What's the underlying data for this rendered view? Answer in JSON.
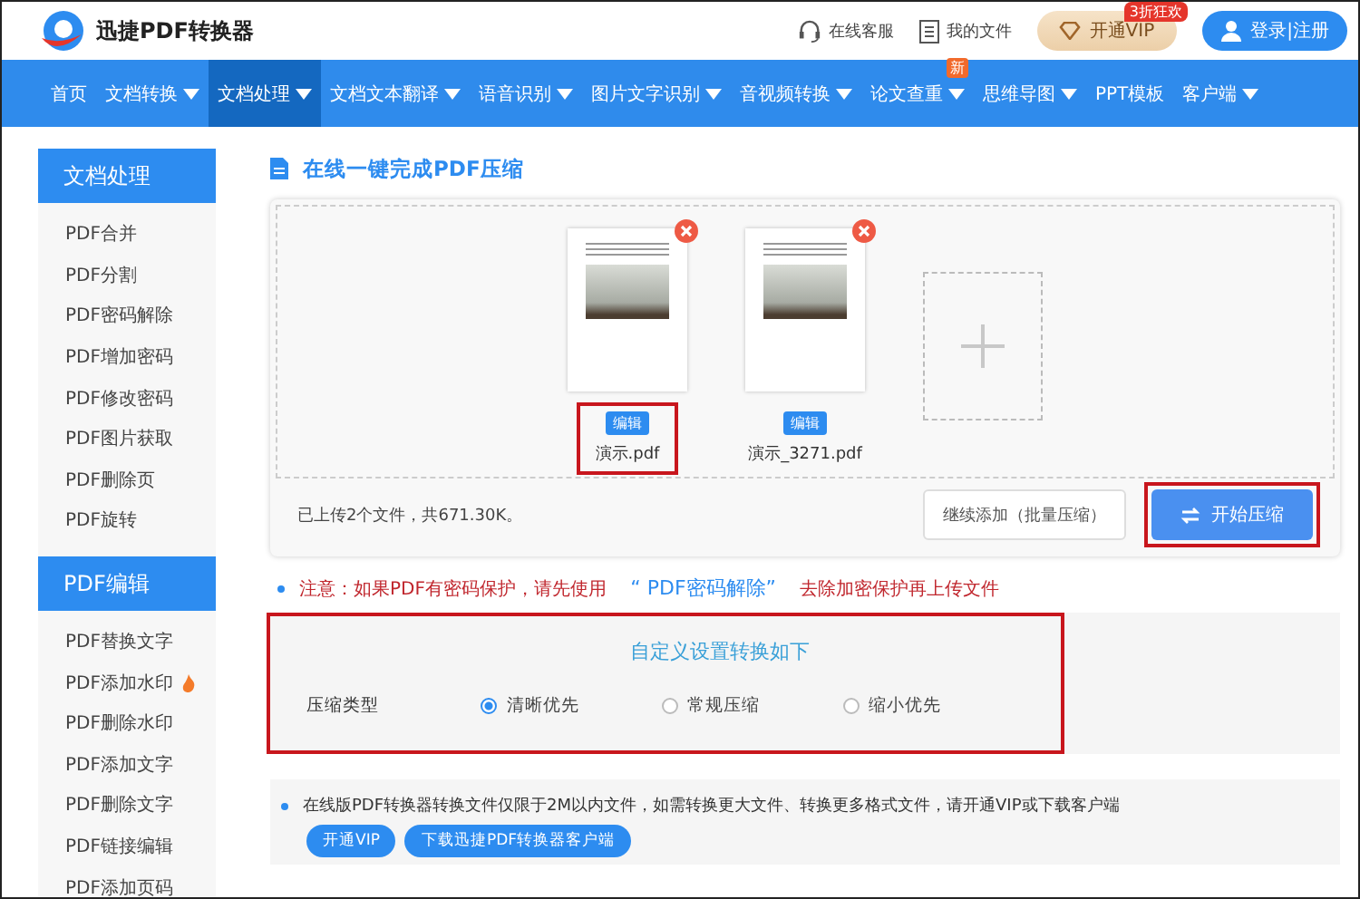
{
  "brand": {
    "name": "迅捷PDF转换器"
  },
  "top_links": [
    {
      "kind": "headset",
      "label": "在线客服"
    },
    {
      "kind": "file",
      "label": "我的文件"
    }
  ],
  "vip": {
    "label": "开通VIP",
    "badge": "3折狂欢"
  },
  "login": {
    "label": "登录|注册"
  },
  "nav": [
    {
      "label": "首页",
      "dropdown": false,
      "selected": false
    },
    {
      "label": "文档转换",
      "dropdown": true,
      "selected": false
    },
    {
      "label": "文档处理",
      "dropdown": true,
      "selected": true
    },
    {
      "label": "文档文本翻译",
      "dropdown": true,
      "selected": false
    },
    {
      "label": "语音识别",
      "dropdown": true,
      "selected": false
    },
    {
      "label": "图片文字识别",
      "dropdown": true,
      "selected": false
    },
    {
      "label": "音视频转换",
      "dropdown": true,
      "selected": false
    },
    {
      "label": "论文查重",
      "dropdown": true,
      "selected": false,
      "badge": "新"
    },
    {
      "label": "思维导图",
      "dropdown": true,
      "selected": false
    },
    {
      "label": "PPT模板",
      "dropdown": false,
      "selected": false
    },
    {
      "label": "客户端",
      "dropdown": true,
      "selected": false
    }
  ],
  "sidebar": [
    {
      "title": "文档处理",
      "items": [
        {
          "label": "PDF合并",
          "hot": false
        },
        {
          "label": "PDF分割",
          "hot": false
        },
        {
          "label": "PDF密码解除",
          "hot": false
        },
        {
          "label": "PDF增加密码",
          "hot": false
        },
        {
          "label": "PDF修改密码",
          "hot": false
        },
        {
          "label": "PDF图片获取",
          "hot": false
        },
        {
          "label": "PDF删除页",
          "hot": false
        },
        {
          "label": "PDF旋转",
          "hot": false
        }
      ]
    },
    {
      "title": "PDF编辑",
      "items": [
        {
          "label": "PDF替换文字",
          "hot": false
        },
        {
          "label": "PDF添加水印",
          "hot": true
        },
        {
          "label": "PDF删除水印",
          "hot": false
        },
        {
          "label": "PDF添加文字",
          "hot": false
        },
        {
          "label": "PDF删除文字",
          "hot": false
        },
        {
          "label": "PDF链接编辑",
          "hot": false
        },
        {
          "label": "PDF添加页码",
          "hot": false
        }
      ]
    }
  ],
  "heading": "在线一键完成PDF压缩",
  "files": [
    {
      "name": "演示.pdf",
      "edit": "编辑",
      "highlighted": true
    },
    {
      "name": "演示_3271.pdf",
      "edit": "编辑",
      "highlighted": false
    }
  ],
  "upload_status": "已上传2个文件，共671.30K。",
  "add_more": {
    "label": "继续添加（批量压缩）"
  },
  "start": {
    "label": "开始压缩",
    "highlighted": true
  },
  "notice": {
    "before": "注意：如果PDF有密码保护，请先使用",
    "link": "“ PDF密码解除”",
    "after": "去除加密保护再上传文件"
  },
  "settings": {
    "title": "自定义设置转换如下",
    "label": "压缩类型",
    "highlighted": true,
    "options": [
      {
        "label": "清晰优先",
        "selected": true
      },
      {
        "label": "常规压缩",
        "selected": false
      },
      {
        "label": "缩小优先",
        "selected": false
      }
    ]
  },
  "info": {
    "text": "在线版PDF转换器转换文件仅限于2M以内文件，如需转换更大文件、转换更多格式文件，请开通VIP或下载客户端",
    "buttons": [
      {
        "label": "开通VIP"
      },
      {
        "label": "下载迅捷PDF转换器客户端"
      }
    ]
  }
}
